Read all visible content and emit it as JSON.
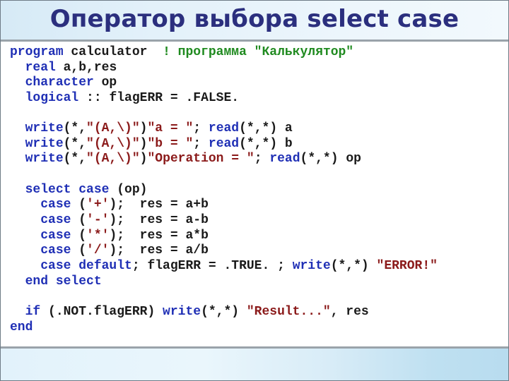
{
  "slide": {
    "title": "Оператор выбора select case"
  },
  "colors": {
    "title": "#2b2f7e",
    "keyword": "#1f2fb5",
    "string": "#8b1a1a",
    "comment": "#1f8a1f",
    "text": "#1a1a1a"
  },
  "code": {
    "lines": [
      [
        {
          "t": "kw",
          "v": "program"
        },
        {
          "t": "txt",
          "v": " calculator  "
        },
        {
          "t": "cmt",
          "v": "! программа \"Калькулятор\""
        }
      ],
      [
        {
          "t": "txt",
          "v": "  "
        },
        {
          "t": "kw",
          "v": "real"
        },
        {
          "t": "txt",
          "v": " a,b,res"
        }
      ],
      [
        {
          "t": "txt",
          "v": "  "
        },
        {
          "t": "kw",
          "v": "character"
        },
        {
          "t": "txt",
          "v": " op"
        }
      ],
      [
        {
          "t": "txt",
          "v": "  "
        },
        {
          "t": "kw",
          "v": "logical"
        },
        {
          "t": "txt",
          "v": " :: flagERR = .FALSE."
        }
      ],
      [],
      [
        {
          "t": "txt",
          "v": "  "
        },
        {
          "t": "kw",
          "v": "write"
        },
        {
          "t": "txt",
          "v": "(*,"
        },
        {
          "t": "str",
          "v": "\"(A,\\)\""
        },
        {
          "t": "txt",
          "v": ")"
        },
        {
          "t": "str",
          "v": "\"a = \""
        },
        {
          "t": "txt",
          "v": "; "
        },
        {
          "t": "kw",
          "v": "read"
        },
        {
          "t": "txt",
          "v": "(*,*) a"
        }
      ],
      [
        {
          "t": "txt",
          "v": "  "
        },
        {
          "t": "kw",
          "v": "write"
        },
        {
          "t": "txt",
          "v": "(*,"
        },
        {
          "t": "str",
          "v": "\"(A,\\)\""
        },
        {
          "t": "txt",
          "v": ")"
        },
        {
          "t": "str",
          "v": "\"b = \""
        },
        {
          "t": "txt",
          "v": "; "
        },
        {
          "t": "kw",
          "v": "read"
        },
        {
          "t": "txt",
          "v": "(*,*) b"
        }
      ],
      [
        {
          "t": "txt",
          "v": "  "
        },
        {
          "t": "kw",
          "v": "write"
        },
        {
          "t": "txt",
          "v": "(*,"
        },
        {
          "t": "str",
          "v": "\"(A,\\)\""
        },
        {
          "t": "txt",
          "v": ")"
        },
        {
          "t": "str",
          "v": "\"Operation = \""
        },
        {
          "t": "txt",
          "v": "; "
        },
        {
          "t": "kw",
          "v": "read"
        },
        {
          "t": "txt",
          "v": "(*,*) op"
        }
      ],
      [],
      [
        {
          "t": "txt",
          "v": "  "
        },
        {
          "t": "kw",
          "v": "select case"
        },
        {
          "t": "txt",
          "v": " (op)"
        }
      ],
      [
        {
          "t": "txt",
          "v": "    "
        },
        {
          "t": "kw",
          "v": "case"
        },
        {
          "t": "txt",
          "v": " ("
        },
        {
          "t": "str",
          "v": "'+'"
        },
        {
          "t": "txt",
          "v": ");  res = a+b"
        }
      ],
      [
        {
          "t": "txt",
          "v": "    "
        },
        {
          "t": "kw",
          "v": "case"
        },
        {
          "t": "txt",
          "v": " ("
        },
        {
          "t": "str",
          "v": "'-'"
        },
        {
          "t": "txt",
          "v": ");  res = a-b"
        }
      ],
      [
        {
          "t": "txt",
          "v": "    "
        },
        {
          "t": "kw",
          "v": "case"
        },
        {
          "t": "txt",
          "v": " ("
        },
        {
          "t": "str",
          "v": "'*'"
        },
        {
          "t": "txt",
          "v": ");  res = a*b"
        }
      ],
      [
        {
          "t": "txt",
          "v": "    "
        },
        {
          "t": "kw",
          "v": "case"
        },
        {
          "t": "txt",
          "v": " ("
        },
        {
          "t": "str",
          "v": "'/'"
        },
        {
          "t": "txt",
          "v": ");  res = a/b"
        }
      ],
      [
        {
          "t": "txt",
          "v": "    "
        },
        {
          "t": "kw",
          "v": "case default"
        },
        {
          "t": "txt",
          "v": "; flagERR = .TRUE. ; "
        },
        {
          "t": "kw",
          "v": "write"
        },
        {
          "t": "txt",
          "v": "(*,*) "
        },
        {
          "t": "str",
          "v": "\"ERROR!\""
        }
      ],
      [
        {
          "t": "txt",
          "v": "  "
        },
        {
          "t": "kw",
          "v": "end select"
        }
      ],
      [],
      [
        {
          "t": "txt",
          "v": "  "
        },
        {
          "t": "kw",
          "v": "if"
        },
        {
          "t": "txt",
          "v": " (.NOT.flagERR) "
        },
        {
          "t": "kw",
          "v": "write"
        },
        {
          "t": "txt",
          "v": "(*,*) "
        },
        {
          "t": "str",
          "v": "\"Result...\""
        },
        {
          "t": "txt",
          "v": ", res"
        }
      ],
      [
        {
          "t": "kw",
          "v": "end"
        }
      ]
    ]
  }
}
